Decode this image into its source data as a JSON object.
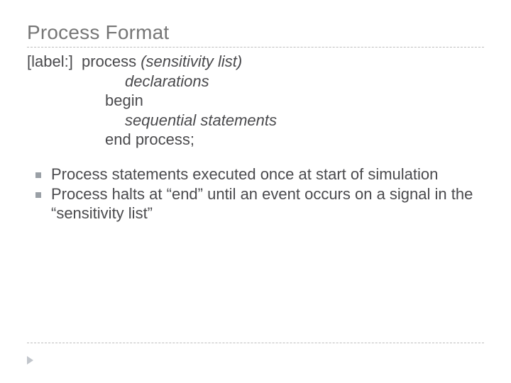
{
  "title": "Process Format",
  "syntax": {
    "line1_prefix": "[label:]  process ",
    "line1_italic": "(sensitivity list)",
    "line2": "declarations",
    "line3": "begin",
    "line4": "sequential statements",
    "line5": "end process;"
  },
  "bullets": [
    "Process statements executed once at start of simulation",
    "Process halts at “end” until an event occurs on a signal in the “sensitivity list”"
  ]
}
